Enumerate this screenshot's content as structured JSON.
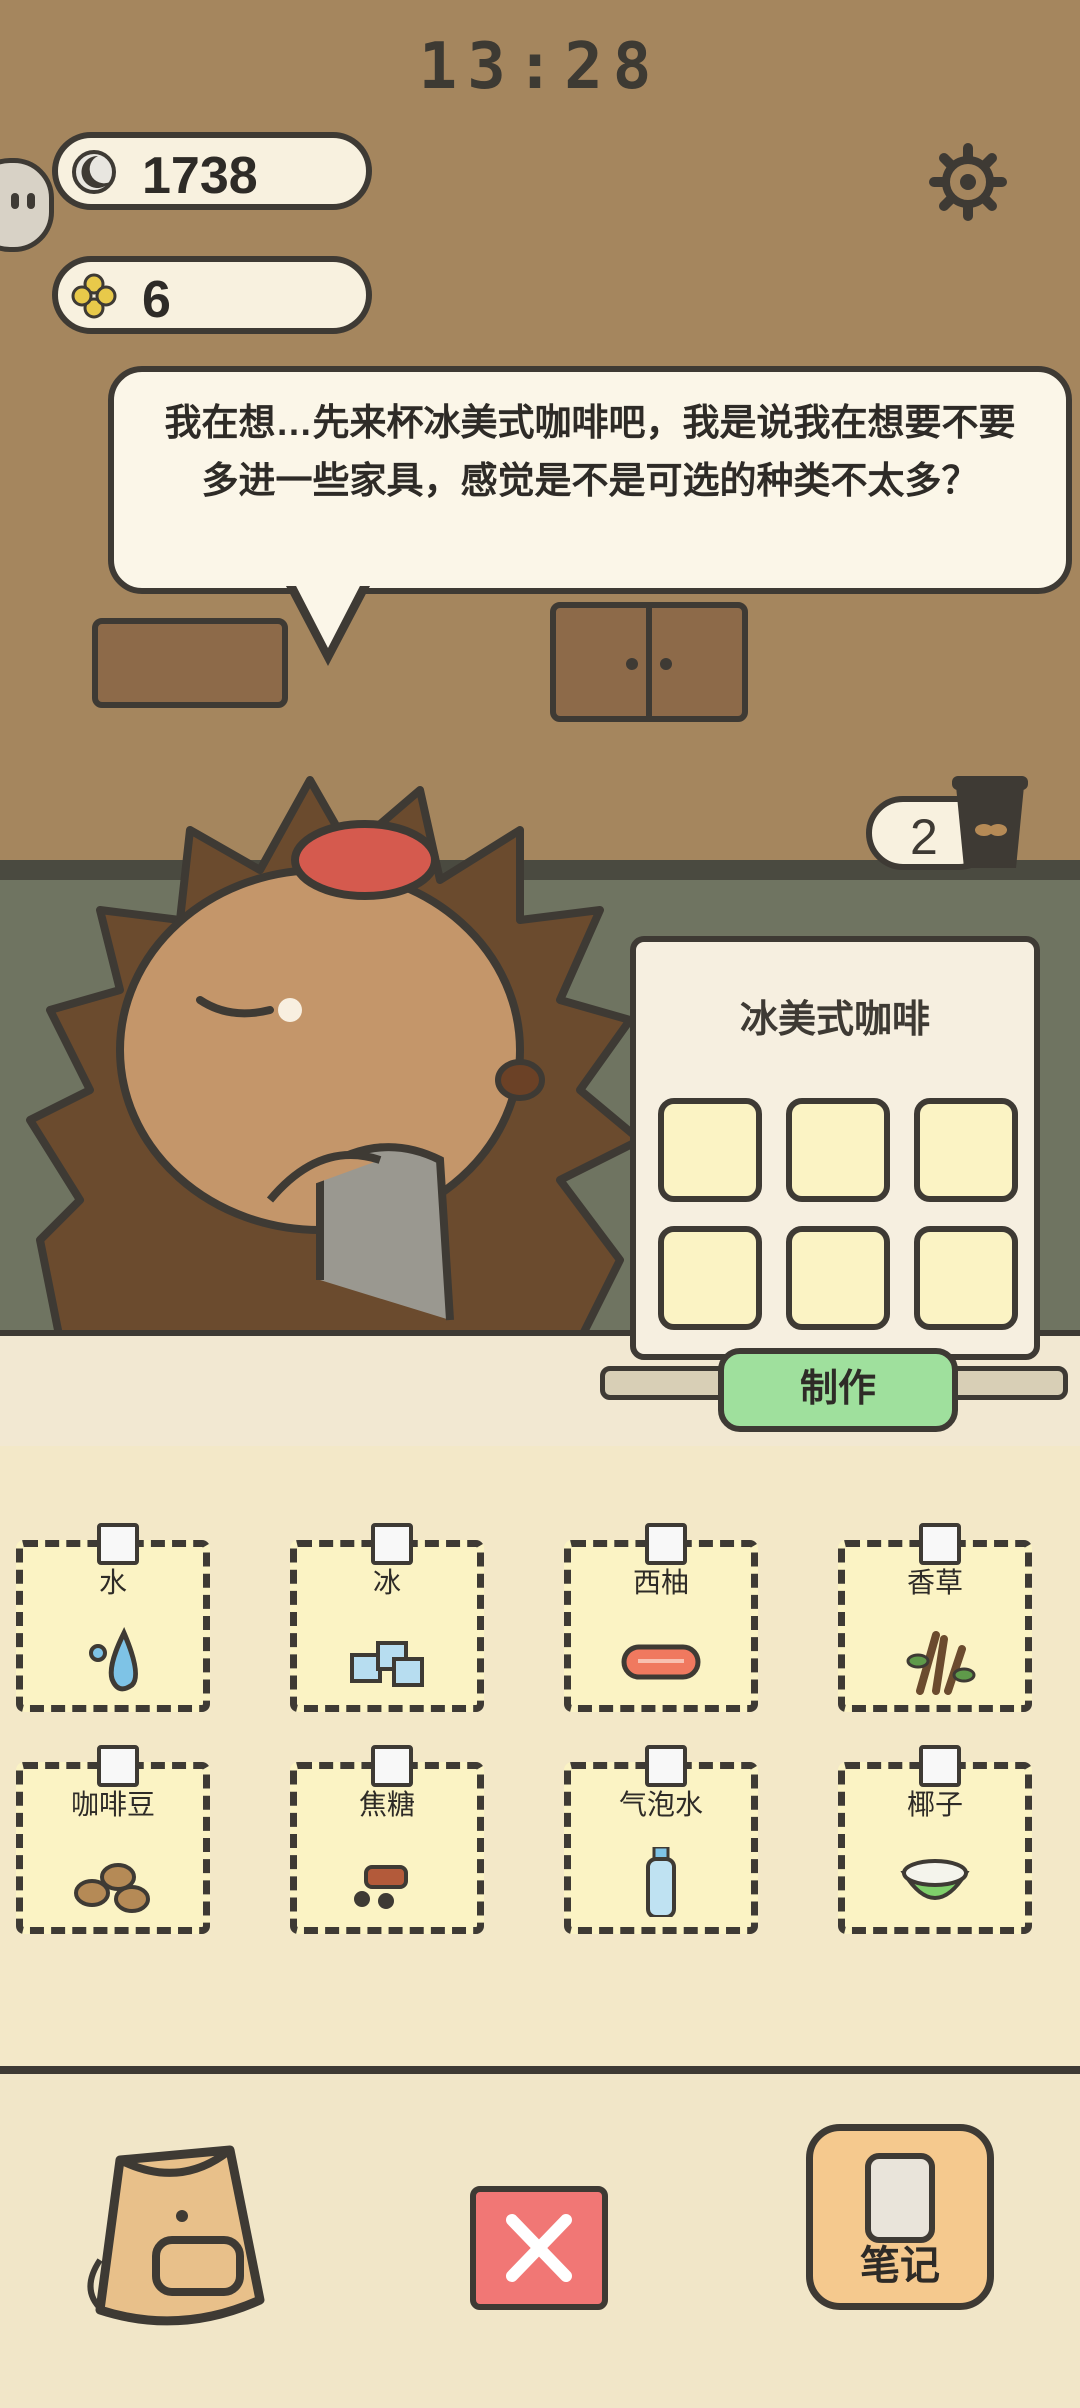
{
  "status": {
    "time": "13:28"
  },
  "currency": {
    "moons": "1738",
    "clovers": "6"
  },
  "speech": {
    "text": "我在想…先来杯冰美式咖啡吧，我是说我在想要不要多进一些家具，感觉是不是可选的种类不太多？"
  },
  "order": {
    "count": "2"
  },
  "recipe": {
    "title": "冰美式咖啡",
    "make_label": "制作",
    "slots": 6
  },
  "ingredients": [
    {
      "label": "水",
      "icon": "water-drop-icon"
    },
    {
      "label": "冰",
      "icon": "ice-cubes-icon"
    },
    {
      "label": "西柚",
      "icon": "grapefruit-icon"
    },
    {
      "label": "香草",
      "icon": "vanilla-herb-icon"
    },
    {
      "label": "咖啡豆",
      "icon": "coffee-beans-icon"
    },
    {
      "label": "焦糖",
      "icon": "caramel-icon"
    },
    {
      "label": "气泡水",
      "icon": "soda-bottle-icon"
    },
    {
      "label": "椰子",
      "icon": "coconut-icon"
    }
  ],
  "bottom_bar": {
    "notes_label": "笔记"
  },
  "colors": {
    "make_button": "#9fe09d",
    "close_button": "#f17775",
    "tile": "#fbf3c4"
  }
}
